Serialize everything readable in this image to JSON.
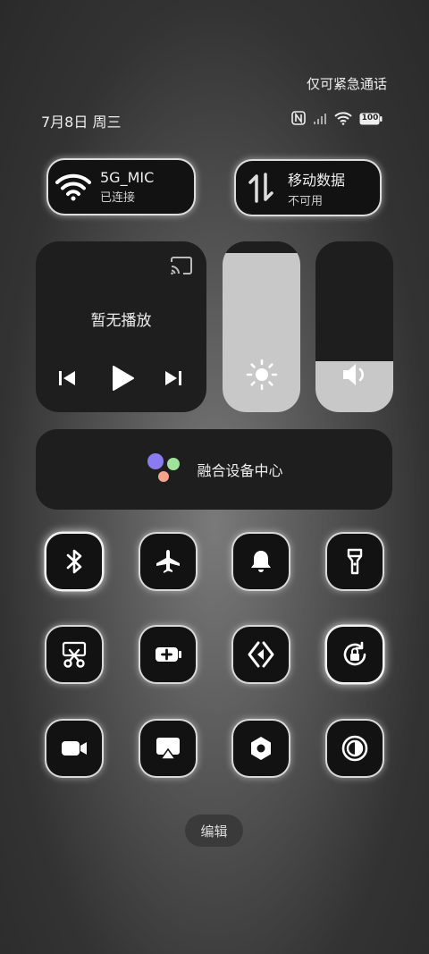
{
  "status": {
    "emergency_text": "仅可紧急通话",
    "date": "7月8日 周三",
    "battery": "100"
  },
  "wifi": {
    "title": "5G_MIC",
    "subtitle": "已连接"
  },
  "mobile_data": {
    "title": "移动数据",
    "subtitle": "不可用"
  },
  "media": {
    "title": "暂无播放"
  },
  "brightness": {
    "level": 0.93
  },
  "volume": {
    "level": 0.3
  },
  "device_hub": {
    "label": "融合设备中心"
  },
  "toggles": [
    {
      "name": "bluetooth-toggle",
      "icon": "bluetooth-icon",
      "active": true
    },
    {
      "name": "airplane-mode-toggle",
      "icon": "airplane-icon",
      "active": false
    },
    {
      "name": "ring-toggle",
      "icon": "bell-icon",
      "active": false
    },
    {
      "name": "flashlight-toggle",
      "icon": "flashlight-icon",
      "active": false
    },
    {
      "name": "screenshot-toggle",
      "icon": "scissors-icon",
      "active": false
    },
    {
      "name": "battery-saver-toggle",
      "icon": "battery-plus-icon",
      "active": false
    },
    {
      "name": "cross-device-toggle",
      "icon": "code-brackets-icon",
      "active": false
    },
    {
      "name": "rotation-lock-toggle",
      "icon": "rotation-lock-icon",
      "active": true
    },
    {
      "name": "screen-record-toggle",
      "icon": "video-camera-icon",
      "active": false
    },
    {
      "name": "screen-cast-toggle",
      "icon": "airplay-icon",
      "active": false
    },
    {
      "name": "settings-toggle",
      "icon": "hexagon-nut-icon",
      "active": false
    },
    {
      "name": "dark-mode-toggle",
      "icon": "contrast-icon",
      "active": false
    }
  ],
  "edit": {
    "label": "编辑"
  }
}
